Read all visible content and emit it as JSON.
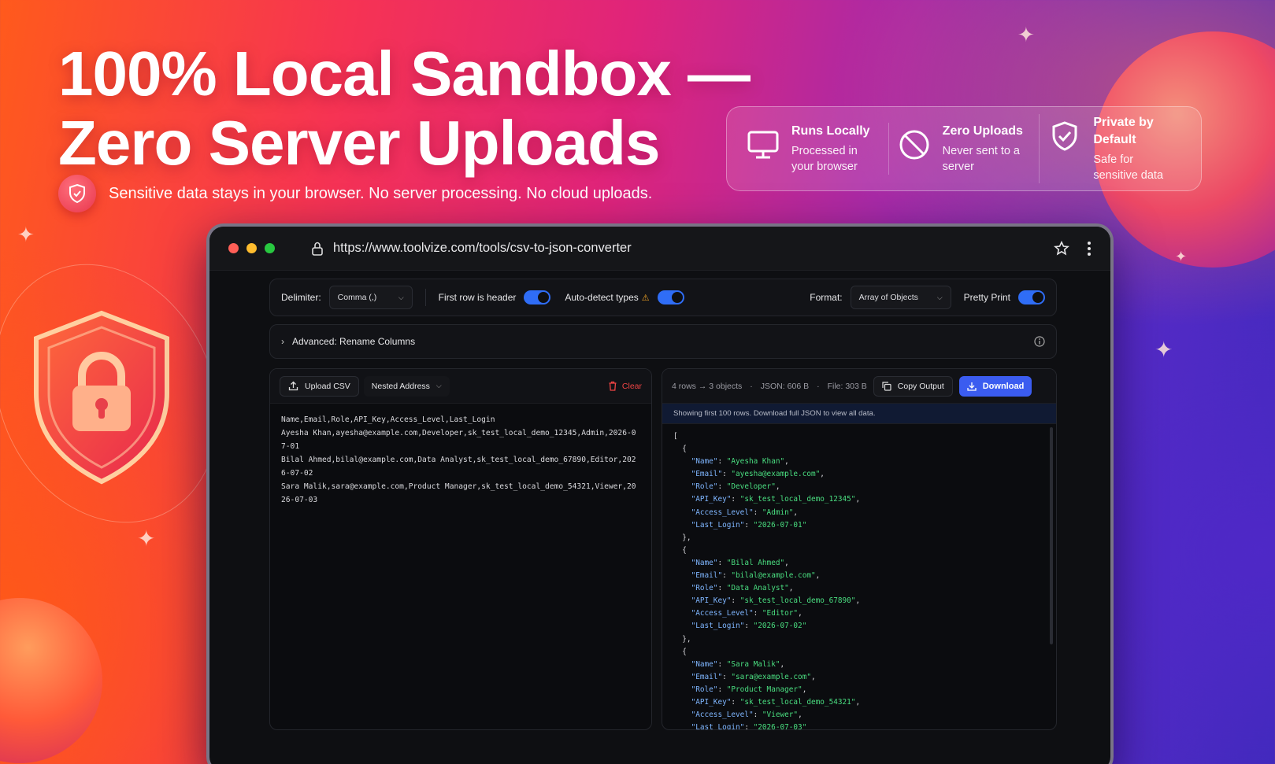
{
  "hero": {
    "title_line1": "100% Local Sandbox —",
    "title_line2": "Zero Server Uploads",
    "subtitle": "Sensitive data stays in your browser. No server processing. No cloud uploads."
  },
  "features": [
    {
      "icon": "monitor-icon",
      "title": "Runs Locally",
      "desc": "Processed in your browser"
    },
    {
      "icon": "no-upload-icon",
      "title": "Zero Uploads",
      "desc": "Never sent to a server"
    },
    {
      "icon": "shield-check-icon",
      "title": "Private by Default",
      "desc": "Safe for sensitive data"
    }
  ],
  "browser": {
    "url": "https://www.toolvize.com/tools/csv-to-json-converter",
    "traffic_light_colors": [
      "#ff5f57",
      "#febc2e",
      "#28c840"
    ]
  },
  "toolbar": {
    "delimiter_label": "Delimiter:",
    "delimiter_value": "Comma (,)",
    "first_row_label": "First row is header",
    "first_row_on": true,
    "auto_detect_label": "Auto-detect types",
    "auto_detect_on": true,
    "format_label": "Format:",
    "format_value": "Array of Objects",
    "pretty_print_label": "Pretty Print",
    "pretty_print_on": true
  },
  "advanced": {
    "label": "Advanced: Rename Columns"
  },
  "input_pane": {
    "upload_label": "Upload CSV",
    "preset_value": "Nested Address",
    "clear_label": "Clear",
    "csv_text": "Name,Email,Role,API_Key,Access_Level,Last_Login\nAyesha Khan,ayesha@example.com,Developer,sk_test_local_demo_12345,Admin,2026-07-01\nBilal Ahmed,bilal@example.com,Data Analyst,sk_test_local_demo_67890,Editor,2026-07-02\nSara Malik,sara@example.com,Product Manager,sk_test_local_demo_54321,Viewer,2026-07-03"
  },
  "output_pane": {
    "rows_stat": "4 rows → 3 objects",
    "json_size": "JSON: 606 B",
    "file_size": "File: 303 B",
    "copy_label": "Copy Output",
    "download_label": "Download",
    "notice": "Showing first 100 rows. Download full JSON to view all data.",
    "json_lines": [
      {
        "t": "["
      },
      {
        "t": "  {"
      },
      {
        "k": "Name",
        "v": "Ayesha Khan"
      },
      {
        "k": "Email",
        "v": "ayesha@example.com"
      },
      {
        "k": "Role",
        "v": "Developer"
      },
      {
        "k": "API_Key",
        "v": "sk_test_local_demo_12345"
      },
      {
        "k": "Access_Level",
        "v": "Admin"
      },
      {
        "k": "Last_Login",
        "v": "2026-07-01",
        "last": true
      },
      {
        "t": "  },"
      },
      {
        "t": "  {"
      },
      {
        "k": "Name",
        "v": "Bilal Ahmed"
      },
      {
        "k": "Email",
        "v": "bilal@example.com"
      },
      {
        "k": "Role",
        "v": "Data Analyst"
      },
      {
        "k": "API_Key",
        "v": "sk_test_local_demo_67890"
      },
      {
        "k": "Access_Level",
        "v": "Editor"
      },
      {
        "k": "Last_Login",
        "v": "2026-07-02",
        "last": true
      },
      {
        "t": "  },"
      },
      {
        "t": "  {"
      },
      {
        "k": "Name",
        "v": "Sara Malik"
      },
      {
        "k": "Email",
        "v": "sara@example.com"
      },
      {
        "k": "Role",
        "v": "Product Manager"
      },
      {
        "k": "API_Key",
        "v": "sk_test_local_demo_54321"
      },
      {
        "k": "Access_Level",
        "v": "Viewer"
      },
      {
        "k": "Last_Login",
        "v": "2026-07-03",
        "last": true
      }
    ]
  }
}
